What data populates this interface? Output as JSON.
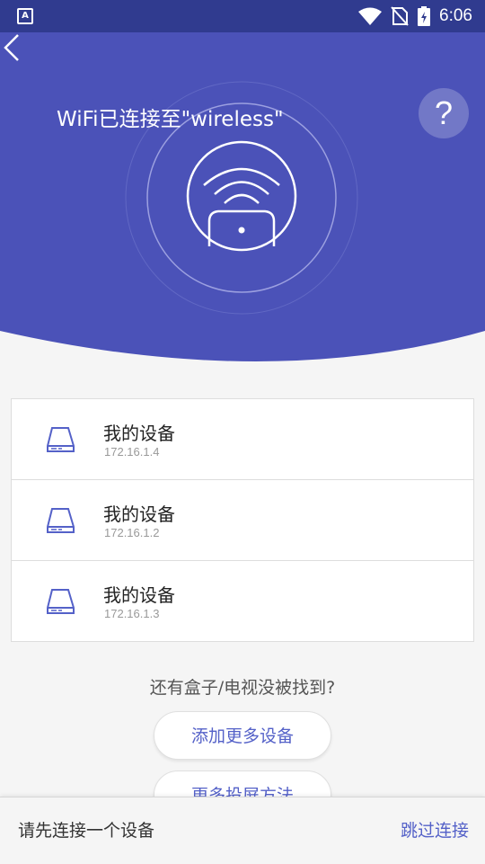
{
  "status_bar": {
    "time": "6:06",
    "app_letter": "A",
    "icons": [
      "wifi-icon",
      "no-sim-icon",
      "battery-icon"
    ]
  },
  "header": {
    "title": "WiFi已连接至\"wireless\"",
    "help_label": "?",
    "center_icon": "router-wifi-icon"
  },
  "devices": [
    {
      "name": "我的设备",
      "ip": "172.16.1.4",
      "icon": "device-box-icon"
    },
    {
      "name": "我的设备",
      "ip": "172.16.1.2",
      "icon": "device-box-icon"
    },
    {
      "name": "我的设备",
      "ip": "172.16.1.3",
      "icon": "device-box-icon"
    }
  ],
  "not_found": {
    "question": "还有盒子/电视没被找到?",
    "add_button": "添加更多设备",
    "more_button": "更多投屏方法"
  },
  "footer": {
    "hint": "请先连接一个设备",
    "skip_label": "跳过连接"
  },
  "colors": {
    "header_bg": "#4b52b8",
    "status_bg": "#303b8f",
    "accent": "#5461c8"
  }
}
